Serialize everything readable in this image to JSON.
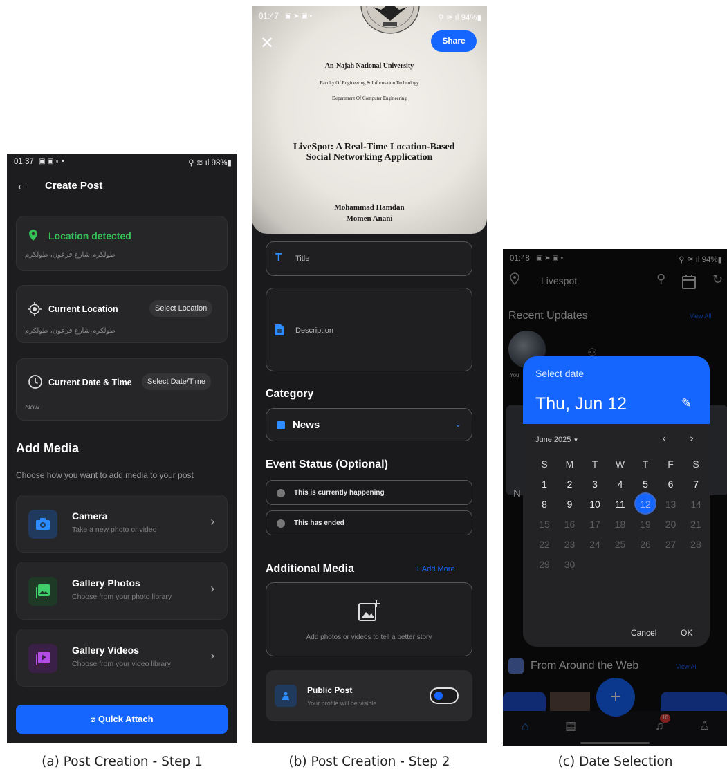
{
  "captions": {
    "a": "(a) Post Creation - Step 1",
    "b": "(b) Post Creation - Step 2",
    "c": "(c) Date Selection"
  },
  "phone_a": {
    "status": {
      "time": "01:37",
      "right": "98%"
    },
    "appbar": {
      "title": "Create Post"
    },
    "location_detected": {
      "title": "Location detected",
      "address": "طولكرم،شارع فرعون، طولكرم"
    },
    "current_location": {
      "title": "Current Location",
      "button": "Select Location",
      "address": "طولكرم،شارع فرعون، طولكرم"
    },
    "current_datetime": {
      "title": "Current Date & Time",
      "button": "Select Date/Time",
      "value": "Now"
    },
    "add_media": {
      "title": "Add Media",
      "subtitle": "Choose how you want to add media to your post"
    },
    "media_options": [
      {
        "title": "Camera",
        "subtitle": "Take a new photo or video",
        "color": "#1f3a5c",
        "icon_color": "#2d8cff"
      },
      {
        "title": "Gallery Photos",
        "subtitle": "Choose from your photo library",
        "color": "#1e3a26",
        "icon_color": "#3fcf6a"
      },
      {
        "title": "Gallery Videos",
        "subtitle": "Choose from your video library",
        "color": "#3a1f47",
        "icon_color": "#b44de6"
      }
    ],
    "quick_attach": "Quick Attach",
    "accent": "#1565ff"
  },
  "phone_b": {
    "status": {
      "time": "01:47",
      "right": "94%"
    },
    "share": "Share",
    "document": {
      "university": "An-Najah National University",
      "faculty": "Faculty Of Engineering & Information Technology",
      "department": "Department Of Computer Engineering",
      "title_line1": "LiveSpot: A Real-Time Location-Based",
      "title_line2": "Social Networking Application",
      "author1": "Mohammad Hamdan",
      "author2": "Momen Anani"
    },
    "title_placeholder": "Title",
    "description_placeholder": "Description",
    "category": {
      "heading": "Category",
      "value": "News"
    },
    "event_status": {
      "heading": "Event Status (Optional)",
      "options": [
        "This is currently happening",
        "This has ended"
      ]
    },
    "additional_media": {
      "heading": "Additional Media",
      "add_more": "+ Add More",
      "hint": "Add photos or videos to tell a better story"
    },
    "public_post": {
      "title": "Public Post",
      "subtitle": "Your profile will be visible",
      "enabled": true
    }
  },
  "phone_c": {
    "status": {
      "time": "01:48",
      "right": "94%"
    },
    "app_title": "Livespot",
    "recent_updates": "Recent Updates",
    "view_all": "View All",
    "story_label": "You",
    "from_web": "From Around the Web",
    "notif_count": "10",
    "date_dialog": {
      "label": "Select date",
      "selected": "Thu, Jun 12",
      "month": "June 2025",
      "weekdays": [
        "S",
        "M",
        "T",
        "W",
        "T",
        "F",
        "S"
      ],
      "weeks": [
        [
          "1",
          "2",
          "3",
          "4",
          "5",
          "6",
          "7"
        ],
        [
          "8",
          "9",
          "10",
          "11",
          "12",
          "13",
          "14"
        ],
        [
          "15",
          "16",
          "17",
          "18",
          "19",
          "20",
          "21"
        ],
        [
          "22",
          "23",
          "24",
          "25",
          "26",
          "27",
          "28"
        ],
        [
          "29",
          "30"
        ]
      ],
      "selected_day": "12",
      "enabled_through": 11,
      "cancel": "Cancel",
      "ok": "OK"
    }
  }
}
